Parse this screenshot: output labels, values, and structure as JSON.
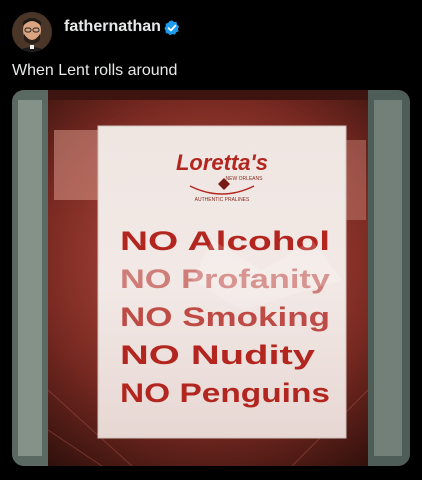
{
  "post": {
    "username": "fathernathan",
    "text": "When Lent rolls around",
    "verified_color": "#1d9bf0"
  },
  "sign": {
    "brand": "Loretta's",
    "brand_sub": "NEW ORLEANS",
    "brand_tagline": "AUTHENTIC PRALINES",
    "lines": [
      "NO Alcohol",
      "NO Profanity",
      "NO Smoking",
      "NO Nudity",
      "NO Penguins"
    ]
  },
  "icons": {
    "verified": "verified-badge-icon"
  }
}
